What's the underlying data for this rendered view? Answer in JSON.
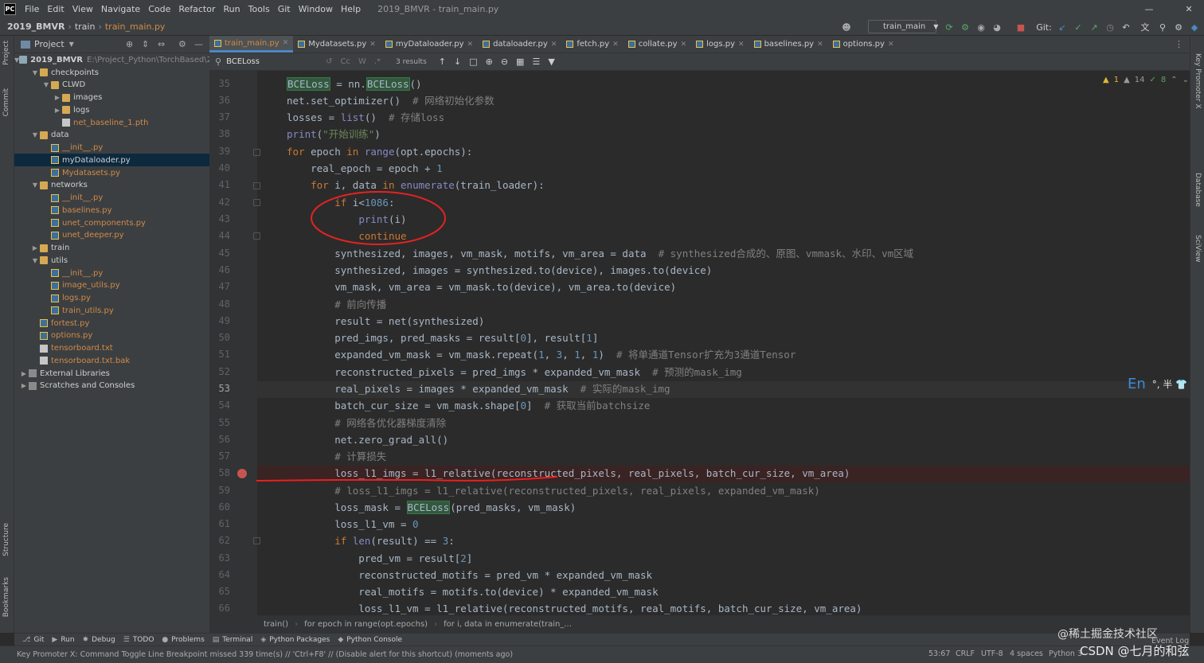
{
  "menubar": {
    "logo": "PC",
    "items": [
      "File",
      "Edit",
      "View",
      "Navigate",
      "Code",
      "Refactor",
      "Run",
      "Tools",
      "Git",
      "Window",
      "Help"
    ],
    "window_title": "2019_BMVR - train_main.py"
  },
  "navbar": {
    "crumbs": [
      "2019_BMVR",
      "train",
      "train_main.py"
    ],
    "run_config": "train_main",
    "git_label": "Git:"
  },
  "project_panel": {
    "title": "Project",
    "root_name": "2019_BMVR",
    "root_path": "E:\\Project_Python\\TorchBased\\20",
    "tree": [
      {
        "label": "checkpoints",
        "type": "folder"
      },
      {
        "label": "CLWD",
        "type": "folder"
      },
      {
        "label": "images",
        "type": "folder"
      },
      {
        "label": "logs",
        "type": "folder"
      },
      {
        "label": "net_baseline_1.pth",
        "type": "file"
      },
      {
        "label": "data",
        "type": "folder"
      },
      {
        "label": "__init__.py",
        "type": "py"
      },
      {
        "label": "myDataloader.py",
        "type": "py"
      },
      {
        "label": "Mydatasets.py",
        "type": "py"
      },
      {
        "label": "networks",
        "type": "folder"
      },
      {
        "label": "__init__.py",
        "type": "py"
      },
      {
        "label": "baselines.py",
        "type": "py"
      },
      {
        "label": "unet_components.py",
        "type": "py"
      },
      {
        "label": "unet_deeper.py",
        "type": "py"
      },
      {
        "label": "train",
        "type": "folder"
      },
      {
        "label": "utils",
        "type": "folder"
      },
      {
        "label": "__init__.py",
        "type": "py"
      },
      {
        "label": "image_utils.py",
        "type": "py"
      },
      {
        "label": "logs.py",
        "type": "py"
      },
      {
        "label": "train_utils.py",
        "type": "py"
      },
      {
        "label": "fortest.py",
        "type": "py"
      },
      {
        "label": "options.py",
        "type": "py"
      },
      {
        "label": "tensorboard.txt",
        "type": "txt"
      },
      {
        "label": "tensorboard.txt.bak",
        "type": "txt"
      },
      {
        "label": "External Libraries",
        "type": "lib"
      },
      {
        "label": "Scratches and Consoles",
        "type": "lib"
      }
    ]
  },
  "tabs": [
    "train_main.py",
    "Mydatasets.py",
    "myDataloader.py",
    "dataloader.py",
    "fetch.py",
    "collate.py",
    "logs.py",
    "baselines.py",
    "options.py"
  ],
  "find": {
    "query": "BCELoss",
    "results": "3 results",
    "cc": "Cc",
    "w": "W"
  },
  "inspections": {
    "warnings": "1",
    "typos": "14",
    "ok": "8"
  },
  "input_indicator": {
    "lang": "En",
    "rest": "°, 半 👕"
  },
  "left_strip": {
    "project": "Project",
    "commit": "Commit",
    "structure": "Structure",
    "bookmarks": "Bookmarks"
  },
  "right_strip": {
    "key_promoter": "Key Promoter X",
    "database": "Database",
    "sciview": "SciView"
  },
  "code": {
    "line_numbers": [
      "35",
      "36",
      "37",
      "38",
      "39",
      "40",
      "41",
      "42",
      "43",
      "44",
      "45",
      "46",
      "47",
      "48",
      "49",
      "50",
      "51",
      "52",
      "53",
      "54",
      "55",
      "56",
      "57",
      "58",
      "59",
      "60",
      "61",
      "62",
      "63",
      "64",
      "65",
      "66"
    ],
    "comments": {
      "36": "# 网络初始化参数",
      "37": "# 存储loss",
      "45": "# synthesized合成的、原图、vmmask、水印、vm区域",
      "48": "# 前向传播",
      "51": "# 将单通道Tensor扩充为3通道Tensor",
      "52": "# 预测的mask_img",
      "53": "# 实际的mask_img",
      "54": "# 获取当前batchsize",
      "55": "# 网络各优化器梯度清除",
      "57": "# 计算损失",
      "59": "# loss_l1_imgs = l1_relative(reconstructed_pixels, real_pixels, expanded_vm_mask)"
    },
    "strings": {
      "38": "\"开始训练\""
    }
  },
  "breadcrumb": [
    "train()",
    "for epoch in range(opt.epochs)",
    "for i, data in enumerate(train_..."
  ],
  "tool_windows": [
    "Git",
    "Run",
    "Debug",
    "TODO",
    "Problems",
    "Terminal",
    "Python Packages",
    "Python Console"
  ],
  "status": {
    "message": "Key Promoter X: Command Toggle Line Breakpoint missed 339 time(s) // 'Ctrl+F8' // (Disable alert for this shortcut) (moments ago)",
    "position": "53:67",
    "line_sep": "CRLF",
    "encoding": "UTF-8",
    "indent": "4 spaces",
    "interpreter": "Python 3",
    "event_log": "Event Log"
  },
  "watermark": {
    "line1": "@稀土掘金技术社区",
    "line2": "CSDN @七月的和弦"
  },
  "colors": {
    "keyword": "#cc7832",
    "string": "#6a8759",
    "number": "#6897bb",
    "comment": "#808080",
    "builtin": "#8888c6",
    "breakpoint": "#c75450",
    "annotation": "#e52222",
    "accent": "#4a88c7"
  }
}
